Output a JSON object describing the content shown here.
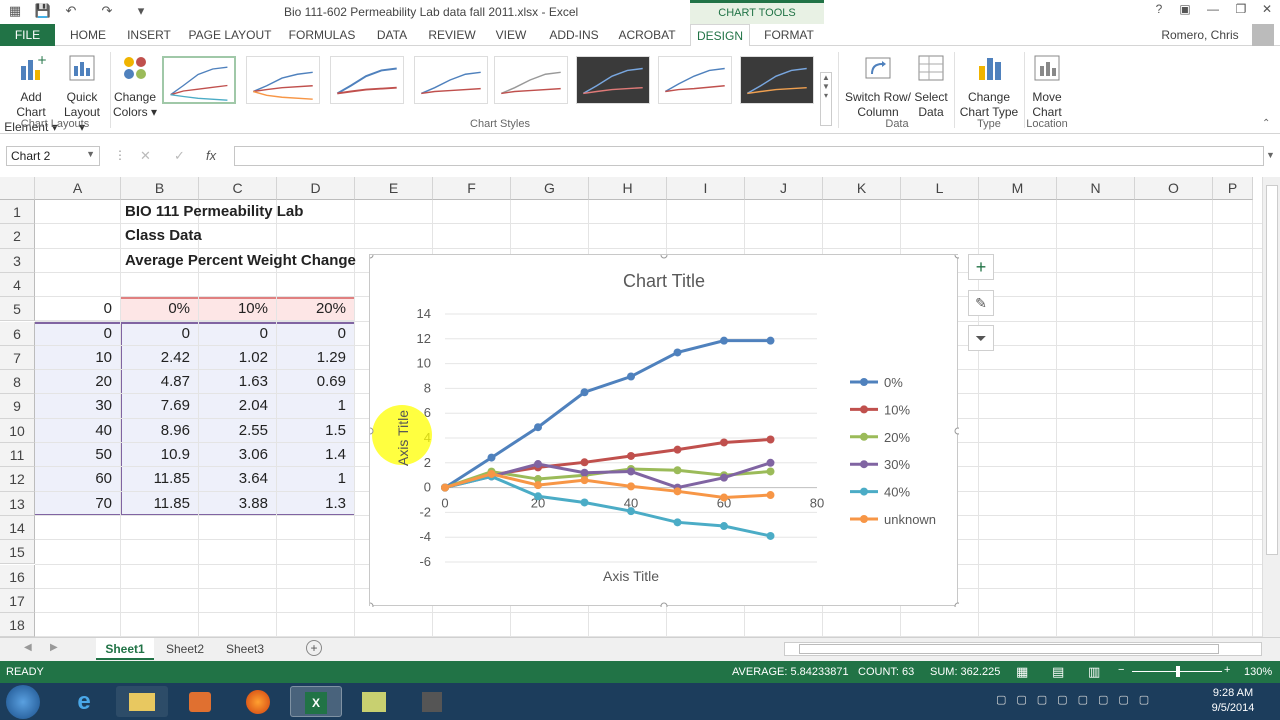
{
  "window": {
    "title": "Bio 111-602 Permeability Lab data fall 2011.xlsx - Excel",
    "context_tab": "CHART TOOLS",
    "user": "Romero, Chris"
  },
  "tabs": [
    "FILE",
    "HOME",
    "INSERT",
    "PAGE LAYOUT",
    "FORMULAS",
    "DATA",
    "REVIEW",
    "VIEW",
    "ADD-INS",
    "ACROBAT",
    "DESIGN",
    "FORMAT"
  ],
  "ribbon": {
    "add_chart_element": [
      "Add Chart",
      "Element"
    ],
    "quick_layout": [
      "Quick",
      "Layout"
    ],
    "change_colors": [
      "Change",
      "Colors"
    ],
    "group_layouts": "Chart Layouts",
    "group_styles": "Chart Styles",
    "switch_row_col": [
      "Switch Row/",
      "Column"
    ],
    "select_data": [
      "Select",
      "Data"
    ],
    "group_data": "Data",
    "change_type": [
      "Change",
      "Chart Type"
    ],
    "group_type": "Type",
    "move_chart": [
      "Move",
      "Chart"
    ],
    "group_location": "Location"
  },
  "formula_bar": {
    "name_box": "Chart 2",
    "fx": "fx",
    "value": ""
  },
  "columns": [
    "A",
    "B",
    "C",
    "D",
    "E",
    "F",
    "G",
    "H",
    "I",
    "J",
    "K",
    "L",
    "M",
    "N",
    "O",
    "P"
  ],
  "rows": [
    "1",
    "2",
    "3",
    "4",
    "5",
    "6",
    "7",
    "8",
    "9",
    "10",
    "11",
    "12",
    "13",
    "14",
    "15",
    "16",
    "17",
    "18"
  ],
  "cells": {
    "B1": "BIO 111 Permeability Lab",
    "B2": "Class Data",
    "B3": "Average Percent Weight Change",
    "A5": "0",
    "B5": "0%",
    "C5": "10%",
    "D5": "20%",
    "A6": "0",
    "B6": "0",
    "C6": "0",
    "D6": "0",
    "A7": "10",
    "B7": "2.42",
    "C7": "1.02",
    "D7": "1.29",
    "A8": "20",
    "B8": "4.87",
    "C8": "1.63",
    "D8": "0.69",
    "A9": "30",
    "B9": "7.69",
    "C9": "2.04",
    "D9": "1",
    "A10": "40",
    "B10": "8.96",
    "C10": "2.55",
    "D10": "1.5",
    "A11": "50",
    "B11": "10.9",
    "C11": "3.06",
    "D11": "1.4",
    "A12": "60",
    "B12": "11.85",
    "C12": "3.64",
    "D12": "1",
    "A13": "70",
    "B13": "11.85",
    "C13": "3.88",
    "D13": "1.3"
  },
  "sheets": [
    "Sheet1",
    "Sheet2",
    "Sheet3"
  ],
  "status": {
    "mode": "READY",
    "average": "AVERAGE: 5.84233871",
    "count": "COUNT: 63",
    "sum": "SUM: 362.225",
    "zoom": "130%"
  },
  "taskbar": {
    "time": "9:28 AM",
    "date": "9/5/2014"
  },
  "colors": {
    "excel_green": "#217346"
  },
  "chart_data": {
    "type": "line",
    "title": "Chart Title",
    "xlabel": "Axis Title",
    "ylabel": "Axis Title",
    "xlim": [
      0,
      80
    ],
    "ylim": [
      -6,
      14
    ],
    "xticks": [
      0,
      20,
      40,
      60,
      80
    ],
    "yticks": [
      -6,
      -4,
      -2,
      0,
      2,
      4,
      6,
      8,
      10,
      12,
      14
    ],
    "legend": "right",
    "x": [
      0,
      10,
      20,
      30,
      40,
      50,
      60,
      70
    ],
    "series": [
      {
        "name": "0%",
        "color": "#4f81bd",
        "values": [
          0,
          2.42,
          4.87,
          7.69,
          8.96,
          10.9,
          11.85,
          11.85
        ]
      },
      {
        "name": "10%",
        "color": "#c0504d",
        "values": [
          0,
          1.02,
          1.63,
          2.04,
          2.55,
          3.06,
          3.64,
          3.88
        ]
      },
      {
        "name": "20%",
        "color": "#9bbb59",
        "values": [
          0,
          1.29,
          0.69,
          1,
          1.5,
          1.4,
          1,
          1.3
        ]
      },
      {
        "name": "30%",
        "color": "#8064a2",
        "values": [
          0,
          0.9,
          1.9,
          1.2,
          1.3,
          0,
          0.8,
          2.0
        ]
      },
      {
        "name": "40%",
        "color": "#4bacc6",
        "values": [
          0,
          0.9,
          -0.7,
          -1.2,
          -1.9,
          -2.8,
          -3.1,
          -3.9
        ]
      },
      {
        "name": "unknown",
        "color": "#f79646",
        "values": [
          0,
          1.1,
          0.2,
          0.6,
          0.1,
          -0.3,
          -0.8,
          -0.6
        ]
      }
    ]
  }
}
